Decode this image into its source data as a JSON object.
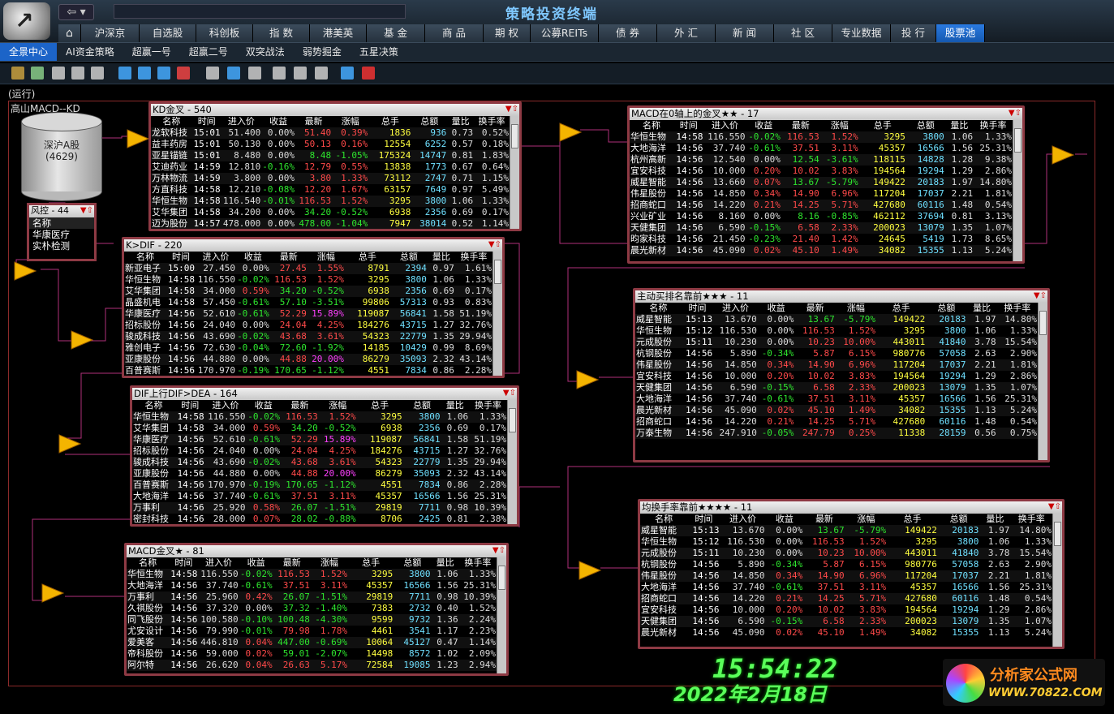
{
  "app": {
    "title": "策略投资终端",
    "status": "(运行)",
    "canvas_label": "高山MACD--KD",
    "watermark": "分析家公式网www.70822.Com"
  },
  "main_nav": [
    "沪深京",
    "自选股",
    "科创板",
    "指 数",
    "港美英",
    "基 金",
    "商 品",
    "期 权",
    "公募REITs",
    "债 券",
    "外 汇",
    "新 闻",
    "社 区",
    "专业数据",
    "投 行",
    "股票池"
  ],
  "main_nav_active": 15,
  "sub_nav": [
    "全景中心",
    "AI资金策略",
    "超赢一号",
    "超赢二号",
    "双突战法",
    "弱势掘金",
    "五星决策"
  ],
  "sub_nav_active": 0,
  "source": {
    "label_line1": "深沪A股",
    "label_line2": "(4629)"
  },
  "risk": {
    "title": "风控 - 44",
    "header": "名称",
    "items": [
      "华康医疗",
      "实朴检测"
    ]
  },
  "icons": {
    "home": "home-icon",
    "back": "back-arrow-icon",
    "filter": "filter-icon",
    "up": "arrow-up-icon",
    "flow": "flow-triangle-icon"
  },
  "colors": {
    "up": "#ff4a4a",
    "down": "#2ee62e",
    "panel_border": "#8e3a44",
    "active_tab": "#1c64c8"
  },
  "columns": [
    "名称",
    "时间",
    "进入价",
    "收益",
    "最新",
    "涨幅",
    "总手",
    "总额",
    "量比",
    "换手率"
  ],
  "panels": [
    {
      "id": "kd",
      "title": "KD金叉 - 540",
      "rows": [
        [
          "龙软科技",
          "15:01",
          "51.400",
          "0.00%",
          "51.40",
          "0.39%",
          "1836",
          "936",
          "0.73",
          "0.52%"
        ],
        [
          "益丰药房",
          "15:01",
          "50.130",
          "0.00%",
          "50.13",
          "0.16%",
          "12554",
          "6252",
          "0.57",
          "0.18%"
        ],
        [
          "亚星锚链",
          "15:01",
          "8.480",
          "0.00%",
          "8.48",
          "-1.05%",
          "175324",
          "14747",
          "0.81",
          "1.83%"
        ],
        [
          "艾迪药业",
          "14:59",
          "12.810",
          "-0.16%",
          "12.79",
          "0.55%",
          "13838",
          "1773",
          "0.67",
          "0.64%"
        ],
        [
          "万林物流",
          "14:59",
          "3.800",
          "0.00%",
          "3.80",
          "1.33%",
          "73112",
          "2747",
          "0.71",
          "1.15%"
        ],
        [
          "方直科技",
          "14:58",
          "12.210",
          "-0.08%",
          "12.20",
          "1.67%",
          "63157",
          "7649",
          "0.97",
          "5.49%"
        ],
        [
          "华恒生物",
          "14:58",
          "116.540",
          "-0.01%",
          "116.53",
          "1.52%",
          "3295",
          "3800",
          "1.06",
          "1.33%"
        ],
        [
          "艾华集团",
          "14:58",
          "34.200",
          "0.00%",
          "34.20",
          "-0.52%",
          "6938",
          "2356",
          "0.69",
          "0.17%"
        ],
        [
          "迈为股份",
          "14:57",
          "478.000",
          "0.00%",
          "478.00",
          "-1.04%",
          "7947",
          "38014",
          "0.52",
          "1.14%"
        ]
      ]
    },
    {
      "id": "kdif",
      "title": "K>DIF - 220",
      "rows": [
        [
          "新亚电子",
          "15:00",
          "27.450",
          "0.00%",
          "27.45",
          "1.55%",
          "8791",
          "2394",
          "0.97",
          "1.61%"
        ],
        [
          "华恒生物",
          "14:58",
          "116.550",
          "-0.02%",
          "116.53",
          "1.52%",
          "3295",
          "3800",
          "1.06",
          "1.33%"
        ],
        [
          "艾华集团",
          "14:58",
          "34.000",
          "0.59%",
          "34.20",
          "-0.52%",
          "6938",
          "2356",
          "0.69",
          "0.17%"
        ],
        [
          "晶盛机电",
          "14:58",
          "57.450",
          "-0.61%",
          "57.10",
          "-3.51%",
          "99806",
          "57313",
          "0.93",
          "0.83%"
        ],
        [
          "华康医疗",
          "14:56",
          "52.610",
          "-0.61%",
          "52.29",
          "15.89%",
          "119087",
          "56841",
          "1.58",
          "51.19%"
        ],
        [
          "招标股份",
          "14:56",
          "24.040",
          "0.00%",
          "24.04",
          "4.25%",
          "184276",
          "43715",
          "1.27",
          "32.76%"
        ],
        [
          "骏成科技",
          "14:56",
          "43.690",
          "-0.02%",
          "43.68",
          "3.61%",
          "54323",
          "22779",
          "1.35",
          "29.94%"
        ],
        [
          "雅创电子",
          "14:56",
          "72.630",
          "-0.04%",
          "72.60",
          "-1.92%",
          "14185",
          "10429",
          "0.99",
          "8.69%"
        ],
        [
          "亚康股份",
          "14:56",
          "44.880",
          "0.00%",
          "44.88",
          "20.00%",
          "86279",
          "35093",
          "2.32",
          "43.14%"
        ],
        [
          "百普赛斯",
          "14:56",
          "170.970",
          "-0.19%",
          "170.65",
          "-1.12%",
          "4551",
          "7834",
          "0.86",
          "2.28%"
        ]
      ]
    },
    {
      "id": "difdea",
      "title": "DIF上行DIF>DEA - 164",
      "rows": [
        [
          "华恒生物",
          "14:58",
          "116.550",
          "-0.02%",
          "116.53",
          "1.52%",
          "3295",
          "3800",
          "1.06",
          "1.33%"
        ],
        [
          "艾华集团",
          "14:58",
          "34.000",
          "0.59%",
          "34.20",
          "-0.52%",
          "6938",
          "2356",
          "0.69",
          "0.17%"
        ],
        [
          "华康医疗",
          "14:56",
          "52.610",
          "-0.61%",
          "52.29",
          "15.89%",
          "119087",
          "56841",
          "1.58",
          "51.19%"
        ],
        [
          "招标股份",
          "14:56",
          "24.040",
          "0.00%",
          "24.04",
          "4.25%",
          "184276",
          "43715",
          "1.27",
          "32.76%"
        ],
        [
          "骏成科技",
          "14:56",
          "43.690",
          "-0.02%",
          "43.68",
          "3.61%",
          "54323",
          "22779",
          "1.35",
          "29.94%"
        ],
        [
          "亚康股份",
          "14:56",
          "44.880",
          "0.00%",
          "44.88",
          "20.00%",
          "86279",
          "35093",
          "2.32",
          "43.14%"
        ],
        [
          "百普赛斯",
          "14:56",
          "170.970",
          "-0.19%",
          "170.65",
          "-1.12%",
          "4551",
          "7834",
          "0.86",
          "2.28%"
        ],
        [
          "大地海洋",
          "14:56",
          "37.740",
          "-0.61%",
          "37.51",
          "3.11%",
          "45357",
          "16566",
          "1.56",
          "25.31%"
        ],
        [
          "万事利",
          "14:56",
          "25.920",
          "0.58%",
          "26.07",
          "-1.51%",
          "29819",
          "7711",
          "0.98",
          "10.39%"
        ],
        [
          "密封科技",
          "14:56",
          "28.000",
          "0.07%",
          "28.02",
          "-0.88%",
          "8706",
          "2425",
          "0.81",
          "2.38%"
        ]
      ]
    },
    {
      "id": "macd",
      "title": "MACD金叉★ - 81",
      "rows": [
        [
          "华恒生物",
          "14:58",
          "116.550",
          "-0.02%",
          "116.53",
          "1.52%",
          "3295",
          "3800",
          "1.06",
          "1.33%"
        ],
        [
          "大地海洋",
          "14:56",
          "37.740",
          "-0.61%",
          "37.51",
          "3.11%",
          "45357",
          "16566",
          "1.56",
          "25.31%"
        ],
        [
          "万事利",
          "14:56",
          "25.960",
          "0.42%",
          "26.07",
          "-1.51%",
          "29819",
          "7711",
          "0.98",
          "10.39%"
        ],
        [
          "久祺股份",
          "14:56",
          "37.320",
          "0.00%",
          "37.32",
          "-1.40%",
          "7383",
          "2732",
          "0.40",
          "1.52%"
        ],
        [
          "同飞股份",
          "14:56",
          "100.580",
          "-0.10%",
          "100.48",
          "-4.30%",
          "9599",
          "9732",
          "1.36",
          "2.24%"
        ],
        [
          "尤安设计",
          "14:56",
          "79.990",
          "-0.01%",
          "79.98",
          "1.78%",
          "4461",
          "3541",
          "1.17",
          "2.23%"
        ],
        [
          "爱美客",
          "14:56",
          "446.810",
          "0.04%",
          "447.00",
          "-0.69%",
          "10064",
          "45127",
          "0.47",
          "1.14%"
        ],
        [
          "帝科股份",
          "14:56",
          "59.000",
          "0.02%",
          "59.01",
          "-2.07%",
          "14498",
          "8572",
          "1.02",
          "2.09%"
        ],
        [
          "阿尔特",
          "14:56",
          "26.620",
          "0.04%",
          "26.63",
          "5.17%",
          "72584",
          "19085",
          "1.23",
          "2.94%"
        ]
      ]
    },
    {
      "id": "macd0",
      "title": "MACD在0轴上的金叉★★ - 17",
      "rows": [
        [
          "华恒生物",
          "14:58",
          "116.550",
          "-0.02%",
          "116.53",
          "1.52%",
          "3295",
          "3800",
          "1.06",
          "1.33%"
        ],
        [
          "大地海洋",
          "14:56",
          "37.740",
          "-0.61%",
          "37.51",
          "3.11%",
          "45357",
          "16566",
          "1.56",
          "25.31%"
        ],
        [
          "杭州高新",
          "14:56",
          "12.540",
          "0.00%",
          "12.54",
          "-3.61%",
          "118115",
          "14828",
          "1.28",
          "9.38%"
        ],
        [
          "宜安科技",
          "14:56",
          "10.000",
          "0.20%",
          "10.02",
          "3.83%",
          "194564",
          "19294",
          "1.29",
          "2.86%"
        ],
        [
          "威星智能",
          "14:56",
          "13.660",
          "0.07%",
          "13.67",
          "-5.79%",
          "149422",
          "20183",
          "1.97",
          "14.80%"
        ],
        [
          "伟星股份",
          "14:56",
          "14.850",
          "0.34%",
          "14.90",
          "6.96%",
          "117204",
          "17037",
          "2.21",
          "1.81%"
        ],
        [
          "招商蛇口",
          "14:56",
          "14.220",
          "0.21%",
          "14.25",
          "5.71%",
          "427680",
          "60116",
          "1.48",
          "0.54%"
        ],
        [
          "兴业矿业",
          "14:56",
          "8.160",
          "0.00%",
          "8.16",
          "-0.85%",
          "462112",
          "37694",
          "0.81",
          "3.13%"
        ],
        [
          "天健集团",
          "14:56",
          "6.590",
          "-0.15%",
          "6.58",
          "2.33%",
          "200023",
          "13079",
          "1.35",
          "1.07%"
        ],
        [
          "昀家科技",
          "14:56",
          "21.450",
          "-0.23%",
          "21.40",
          "1.42%",
          "24645",
          "5419",
          "1.73",
          "8.65%"
        ],
        [
          "晨光新材",
          "14:56",
          "45.090",
          "0.02%",
          "45.10",
          "1.49%",
          "34082",
          "15355",
          "1.13",
          "5.24%"
        ]
      ]
    },
    {
      "id": "active",
      "title": "主动买排名靠前★★★ - 11",
      "rows": [
        [
          "威星智能",
          "15:13",
          "13.670",
          "0.00%",
          "13.67",
          "-5.79%",
          "149422",
          "20183",
          "1.97",
          "14.80%"
        ],
        [
          "华恒生物",
          "15:12",
          "116.530",
          "0.00%",
          "116.53",
          "1.52%",
          "3295",
          "3800",
          "1.06",
          "1.33%"
        ],
        [
          "元成股份",
          "15:11",
          "10.230",
          "0.00%",
          "10.23",
          "10.00%",
          "443011",
          "41840",
          "3.78",
          "15.54%"
        ],
        [
          "杭钢股份",
          "14:56",
          "5.890",
          "-0.34%",
          "5.87",
          "6.15%",
          "980776",
          "57058",
          "2.63",
          "2.90%"
        ],
        [
          "伟星股份",
          "14:56",
          "14.850",
          "0.34%",
          "14.90",
          "6.96%",
          "117204",
          "17037",
          "2.21",
          "1.81%"
        ],
        [
          "宜安科技",
          "14:56",
          "10.000",
          "0.20%",
          "10.02",
          "3.83%",
          "194564",
          "19294",
          "1.29",
          "2.86%"
        ],
        [
          "天健集团",
          "14:56",
          "6.590",
          "-0.15%",
          "6.58",
          "2.33%",
          "200023",
          "13079",
          "1.35",
          "1.07%"
        ],
        [
          "大地海洋",
          "14:56",
          "37.740",
          "-0.61%",
          "37.51",
          "3.11%",
          "45357",
          "16566",
          "1.56",
          "25.31%"
        ],
        [
          "晨光新材",
          "14:56",
          "45.090",
          "0.02%",
          "45.10",
          "1.49%",
          "34082",
          "15355",
          "1.13",
          "5.24%"
        ],
        [
          "招商蛇口",
          "14:56",
          "14.220",
          "0.21%",
          "14.25",
          "5.71%",
          "427680",
          "60116",
          "1.48",
          "0.54%"
        ],
        [
          "万泰生物",
          "14:56",
          "247.910",
          "-0.05%",
          "247.79",
          "0.25%",
          "11338",
          "28159",
          "0.56",
          "0.75%"
        ]
      ]
    },
    {
      "id": "turnover",
      "title": "均换手率靠前★★★★ - 11",
      "rows": [
        [
          "威星智能",
          "15:13",
          "13.670",
          "0.00%",
          "13.67",
          "-5.79%",
          "149422",
          "20183",
          "1.97",
          "14.80%"
        ],
        [
          "华恒生物",
          "15:12",
          "116.530",
          "0.00%",
          "116.53",
          "1.52%",
          "3295",
          "3800",
          "1.06",
          "1.33%"
        ],
        [
          "元成股份",
          "15:11",
          "10.230",
          "0.00%",
          "10.23",
          "10.00%",
          "443011",
          "41840",
          "3.78",
          "15.54%"
        ],
        [
          "杭钢股份",
          "14:56",
          "5.890",
          "-0.34%",
          "5.87",
          "6.15%",
          "980776",
          "57058",
          "2.63",
          "2.90%"
        ],
        [
          "伟星股份",
          "14:56",
          "14.850",
          "0.34%",
          "14.90",
          "6.96%",
          "117204",
          "17037",
          "2.21",
          "1.81%"
        ],
        [
          "大地海洋",
          "14:56",
          "37.740",
          "-0.61%",
          "37.51",
          "3.11%",
          "45357",
          "16566",
          "1.56",
          "25.31%"
        ],
        [
          "招商蛇口",
          "14:56",
          "14.220",
          "0.21%",
          "14.25",
          "5.71%",
          "427680",
          "60116",
          "1.48",
          "0.54%"
        ],
        [
          "宜安科技",
          "14:56",
          "10.000",
          "0.20%",
          "10.02",
          "3.83%",
          "194564",
          "19294",
          "1.29",
          "2.86%"
        ],
        [
          "天健集团",
          "14:56",
          "6.590",
          "-0.15%",
          "6.58",
          "2.33%",
          "200023",
          "13079",
          "1.35",
          "1.07%"
        ],
        [
          "晨光新材",
          "14:56",
          "45.090",
          "0.02%",
          "45.10",
          "1.49%",
          "34082",
          "15355",
          "1.13",
          "5.24%"
        ]
      ]
    }
  ],
  "clock": {
    "time": "15:54:22",
    "date": "2022年2月18日"
  },
  "brand": {
    "name": "分析家公式网",
    "url": "WWW.70822.COM"
  }
}
